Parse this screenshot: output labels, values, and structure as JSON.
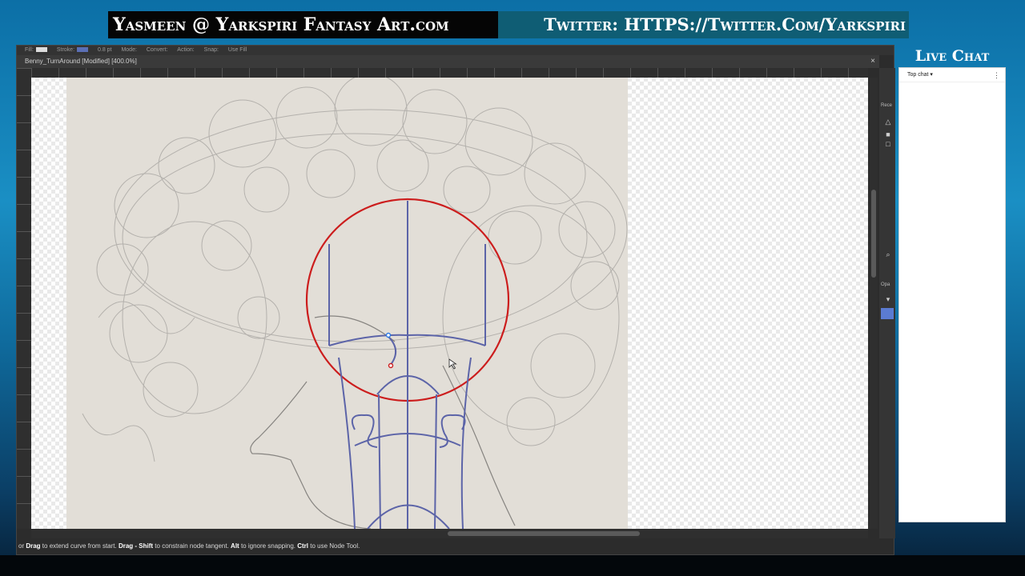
{
  "banners": {
    "left": "Yasmeen @ Yarkspiri Fantasy Art.com",
    "right": "Twitter: HTTPS://Twitter.Com/Yarkspiri"
  },
  "toolbar": {
    "fill_label": "Fill:",
    "stroke_label": "Stroke:",
    "stroke_width": "0.8 pt",
    "mode_label": "Mode:",
    "convert_label": "Convert:",
    "action_label": "Action:",
    "snap_label": "Snap:",
    "use_fill": "Use Fill"
  },
  "document": {
    "tab_title": "Benny_TurnAround [Modified] [400.0%]",
    "close_glyph": "×"
  },
  "right_strip": {
    "recent_label": "Rece",
    "opacity_label": "Opa"
  },
  "status": {
    "p1": "or ",
    "k1": "Drag",
    "p2": " to extend curve from start. ",
    "k2": "Drag",
    "p3": " - ",
    "k3": "Shift",
    "p4": " to constrain node tangent. ",
    "k4": "Alt",
    "p5": " to ignore snapping. ",
    "k5": "Ctrl",
    "p6": " to use Node Tool."
  },
  "chat": {
    "title": "Live Chat",
    "dropdown": "Top chat ▾",
    "menu_glyph": "⋮"
  },
  "colors": {
    "guide_circle": "#cc1d1d",
    "guide_lines": "#5c64a8",
    "window_bg": "#2c2c2c"
  },
  "icons": [
    "fill-swatch-icon",
    "stroke-swatch-icon",
    "close-icon",
    "zoom-icon",
    "dropdown-icon",
    "chat-menu-icon"
  ]
}
